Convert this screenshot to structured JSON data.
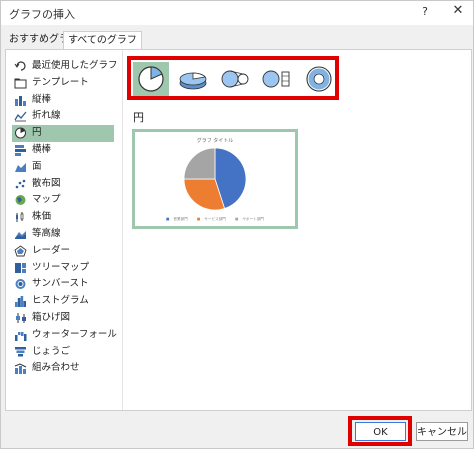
{
  "window": {
    "title": "グラフの挿入",
    "help_label": "?",
    "close_label": "✕"
  },
  "tabs": [
    {
      "label": "おすすめグラフ",
      "active": false
    },
    {
      "label": "すべてのグラフ",
      "active": true
    }
  ],
  "chart_types": [
    {
      "label": "最近使用したグラフ",
      "icon": "recent-icon"
    },
    {
      "label": "テンプレート",
      "icon": "folder-icon"
    },
    {
      "label": "縦棒",
      "icon": "column-chart-icon"
    },
    {
      "label": "折れ線",
      "icon": "line-chart-icon"
    },
    {
      "label": "円",
      "icon": "pie-chart-icon",
      "selected": true
    },
    {
      "label": "横棒",
      "icon": "bar-chart-icon"
    },
    {
      "label": "面",
      "icon": "area-chart-icon"
    },
    {
      "label": "散布図",
      "icon": "scatter-chart-icon"
    },
    {
      "label": "マップ",
      "icon": "map-chart-icon"
    },
    {
      "label": "株価",
      "icon": "stock-chart-icon"
    },
    {
      "label": "等高線",
      "icon": "surface-chart-icon"
    },
    {
      "label": "レーダー",
      "icon": "radar-chart-icon"
    },
    {
      "label": "ツリーマップ",
      "icon": "treemap-chart-icon"
    },
    {
      "label": "サンバースト",
      "icon": "sunburst-chart-icon"
    },
    {
      "label": "ヒストグラム",
      "icon": "histogram-chart-icon"
    },
    {
      "label": "箱ひげ図",
      "icon": "box-whisker-chart-icon"
    },
    {
      "label": "ウォーターフォール",
      "icon": "waterfall-chart-icon"
    },
    {
      "label": "じょうご",
      "icon": "funnel-chart-icon"
    },
    {
      "label": "組み合わせ",
      "icon": "combo-chart-icon"
    }
  ],
  "subtypes": [
    {
      "icon": "pie-subtype-icon",
      "selected": true
    },
    {
      "icon": "3d-pie-subtype-icon",
      "selected": false
    },
    {
      "icon": "pie-of-pie-subtype-icon",
      "selected": false
    },
    {
      "icon": "bar-of-pie-subtype-icon",
      "selected": false
    },
    {
      "icon": "doughnut-subtype-icon",
      "selected": false
    }
  ],
  "section_title": "円",
  "preview": {
    "title": "グラフ タイトル",
    "legend": [
      "営業部門",
      "サービス部門",
      "サポート部門"
    ]
  },
  "chart_data": {
    "type": "pie",
    "title": "グラフ タイトル",
    "categories": [
      "営業部門",
      "サービス部門",
      "サポート部門"
    ],
    "values": [
      45,
      30,
      25
    ],
    "colors": [
      "#4472c4",
      "#ed7d31",
      "#a5a5a5"
    ]
  },
  "colors": {
    "accent": "#9ec7ad",
    "highlight": "#e00000"
  },
  "buttons": {
    "ok": "OK",
    "cancel": "キャンセル"
  }
}
